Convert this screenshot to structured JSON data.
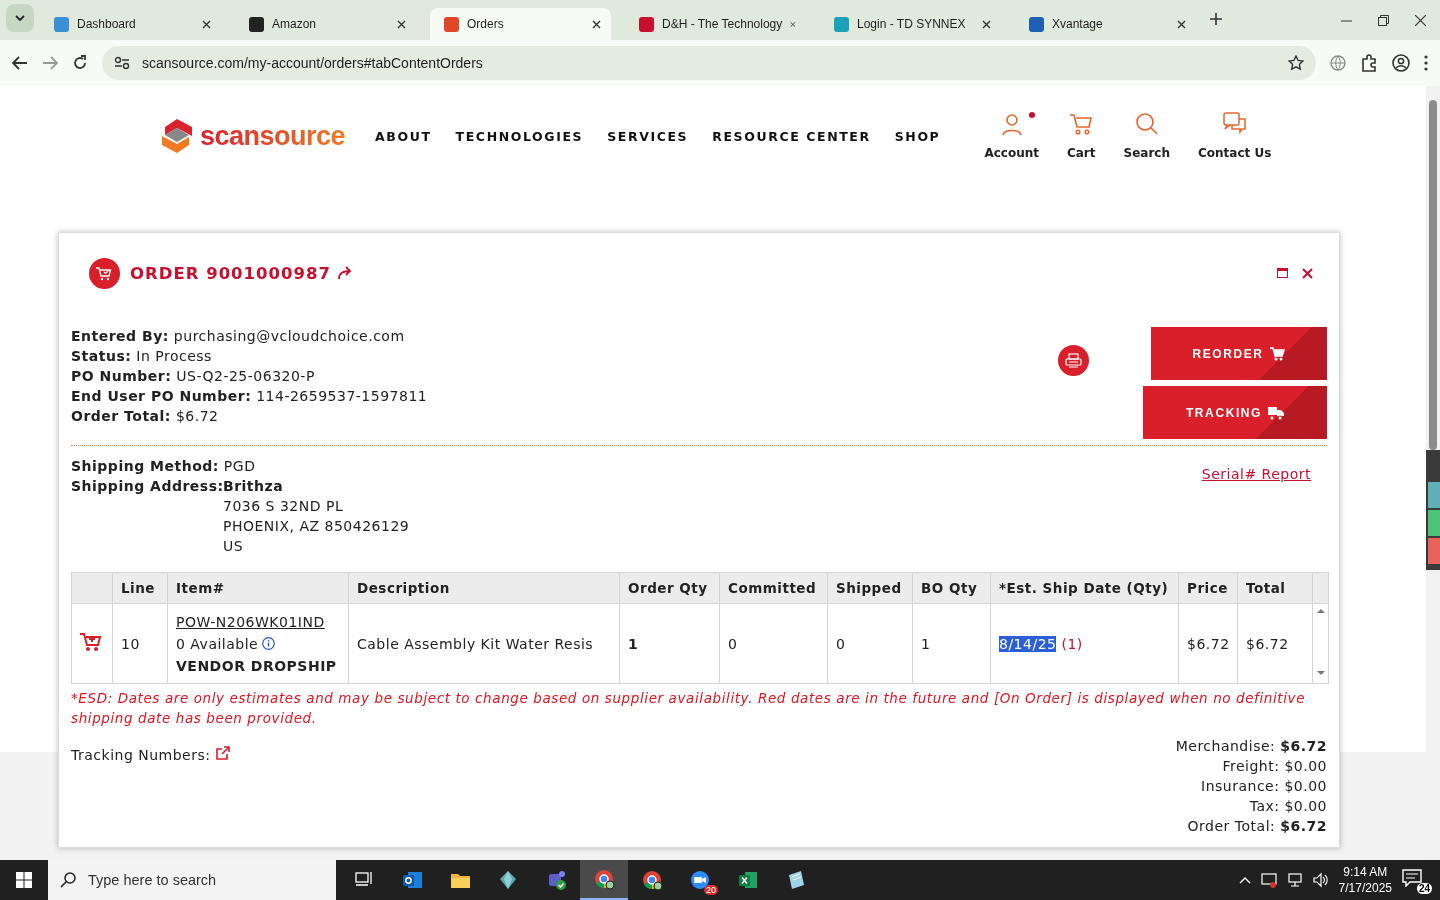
{
  "browser": {
    "tabs": [
      {
        "title": "Dashboard",
        "color": "#3d8fd6",
        "selected": false
      },
      {
        "title": "Amazon",
        "color": "#222222",
        "selected": false
      },
      {
        "title": "Orders",
        "color": "#e0462a",
        "selected": true
      },
      {
        "title": "D&H - The Technology",
        "color": "#c8102e",
        "selected": false
      },
      {
        "title": "Login - TD SYNNEX",
        "color": "#1aa3b8",
        "selected": false
      },
      {
        "title": "Xvantage",
        "color": "#1e5fb3",
        "selected": false
      }
    ],
    "url": "scansource.com/my-account/orders#tabContentOrders"
  },
  "site": {
    "logo": "scansource",
    "nav": [
      "ABOUT",
      "TECHNOLOGIES",
      "SERVICES",
      "RESOURCE CENTER",
      "SHOP"
    ],
    "actions": [
      {
        "label": "Account",
        "kind": "person",
        "notification": true
      },
      {
        "label": "Cart",
        "kind": "cart",
        "notification": false
      },
      {
        "label": "Search",
        "kind": "search",
        "notification": false
      },
      {
        "label": "Contact Us",
        "kind": "chat",
        "notification": false
      }
    ]
  },
  "order": {
    "title": "ORDER 9001000987",
    "details": [
      {
        "label": "Entered By:",
        "value": "purchasing@vcloudchoice.com"
      },
      {
        "label": "Status:",
        "value": "In Process"
      },
      {
        "label": "PO Number:",
        "value": "US-Q2-25-06320-P"
      },
      {
        "label": "End User PO Number:",
        "value": "114-2659537-1597811"
      },
      {
        "label": "Order Total:",
        "value": "$6.72"
      }
    ],
    "buttons": [
      {
        "label": "REORDER",
        "kind": "cart"
      },
      {
        "label": "TRACKING",
        "kind": "truck"
      }
    ],
    "shipping_method": {
      "label": "Shipping Method:",
      "value": "PGD"
    },
    "shipping_address": {
      "label": "Shipping Address:",
      "name": "Brithza",
      "lines": [
        "7036 S 32ND PL",
        "PHOENIX, AZ 850426129",
        "US"
      ]
    },
    "serial_report": "Serial# Report",
    "table": {
      "columns": [
        "Line",
        "Item#",
        "Description",
        "Order Qty",
        "Committed",
        "Shipped",
        "BO Qty",
        "*Est. Ship Date (Qty)",
        "Price",
        "Total"
      ],
      "rows": [
        {
          "line": "10",
          "item": "POW-N206WK01IND",
          "availability": "0 Available",
          "note": "VENDOR DROPSHIP",
          "description": "Cable Assembly Kit Water Resis",
          "order_qty": "1",
          "committed": "0",
          "shipped": "0",
          "bo_qty": "1",
          "ship_date": "8/14/25",
          "ship_date_selected": true,
          "ship_qty": "(1)",
          "price": "$6.72",
          "total": "$6.72"
        }
      ]
    },
    "esd_note": "*ESD: Dates are only estimates and may be subject to change based on supplier availability. Red dates are in the future and [On Order] is displayed when no definitive shipping date has been provided.",
    "tracking_label": "Tracking Numbers:",
    "totals": [
      {
        "label": "Merchandise:",
        "value": "$6.72",
        "emphasis": true
      },
      {
        "label": "Freight:",
        "value": "$0.00",
        "emphasis": false
      },
      {
        "label": "Insurance:",
        "value": "$0.00",
        "emphasis": false
      },
      {
        "label": "Tax:",
        "value": "$0.00",
        "emphasis": false
      },
      {
        "label": "Order Total:",
        "value": "$6.72",
        "emphasis": true
      }
    ]
  },
  "taskbar": {
    "search_placeholder": "Type here to search",
    "apps": [
      {
        "kind": "taskview",
        "selected": false
      },
      {
        "kind": "outlook",
        "selected": false
      },
      {
        "kind": "folder",
        "selected": false
      },
      {
        "kind": "gem",
        "selected": false
      },
      {
        "kind": "teams",
        "selected": false
      },
      {
        "kind": "chrome",
        "selected": true
      },
      {
        "kind": "chrome",
        "selected": false
      },
      {
        "kind": "zoom",
        "selected": false,
        "badge": "20"
      },
      {
        "kind": "excel",
        "selected": false
      },
      {
        "kind": "notes",
        "selected": false
      }
    ],
    "time": "9:14 AM",
    "date": "7/17/2025",
    "notifications": "24"
  }
}
